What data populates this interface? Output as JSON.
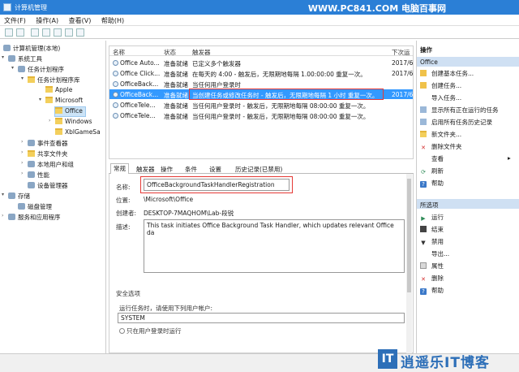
{
  "window": {
    "title": "计算机管理",
    "watermark": "WWW.PC841.COM 电脑百事网"
  },
  "menu": [
    "文件(F)",
    "操作(A)",
    "查看(V)",
    "帮助(H)"
  ],
  "tree": [
    {
      "label": "计算机管理(本地)",
      "icon": "computer-icon"
    },
    {
      "label": "系统工具",
      "icon": "tools-icon"
    },
    {
      "label": "任务计划程序",
      "icon": "clock-icon"
    },
    {
      "label": "任务计划程序库",
      "icon": "folder-icon"
    },
    {
      "label": "Apple",
      "icon": "folder-icon"
    },
    {
      "label": "Microsoft",
      "icon": "folder-icon"
    },
    {
      "label": "Office",
      "icon": "folder-icon"
    },
    {
      "label": "Windows",
      "icon": "folder-icon"
    },
    {
      "label": "XblGameSa",
      "icon": "folder-icon"
    },
    {
      "label": "事件查看器",
      "icon": "event-icon"
    },
    {
      "label": "共享文件夹",
      "icon": "share-icon"
    },
    {
      "label": "本地用户和组",
      "icon": "users-icon"
    },
    {
      "label": "性能",
      "icon": "performance-icon"
    },
    {
      "label": "设备管理器",
      "icon": "device-icon"
    },
    {
      "label": "存储",
      "icon": "storage-icon"
    },
    {
      "label": "磁盘管理",
      "icon": "disk-icon"
    },
    {
      "label": "服务和应用程序",
      "icon": "services-icon"
    }
  ],
  "tasks": {
    "headers": [
      "名称",
      "状态",
      "触发器",
      "下次运"
    ],
    "rows": [
      {
        "name": "Office Auto...",
        "status": "准备就绪",
        "trigger": "已定义多个触发器",
        "next": "2017/6"
      },
      {
        "name": "Office Click...",
        "status": "准备就绪",
        "trigger": "在每天的 4:00 - 触发后，无限期地每隔 1.00:00:00 重复一次。",
        "next": "2017/6"
      },
      {
        "name": "OfficeBack...",
        "status": "准备就绪",
        "trigger": "当任何用户登录时",
        "next": ""
      },
      {
        "name": "OfficeBack...",
        "status": "准备就绪",
        "trigger": "当创建任务或修改任务时 - 触发后，无限期地每隔 1 小时 重复一次。",
        "next": "2017/6"
      },
      {
        "name": "OfficeTele...",
        "status": "准备就绪",
        "trigger": "当任何用户登录时 - 触发后，无限期地每隔 08:00:00 重复一次。",
        "next": ""
      },
      {
        "name": "OfficeTele...",
        "status": "准备就绪",
        "trigger": "当任何用户登录时 - 触发后，无限期地每隔 08:00:00 重复一次。",
        "next": ""
      }
    ]
  },
  "tabs": [
    "常规",
    "触发器",
    "操作",
    "条件",
    "设置",
    "历史记录(已禁用)"
  ],
  "detail": {
    "name_label": "名称:",
    "name_value": "OfficeBackgroundTaskHandlerRegistration",
    "location_label": "位置:",
    "location_value": "\\Microsoft\\Office",
    "author_label": "创建者:",
    "author_value": "DESKTOP-7MAQHOM\\Lab-段锐",
    "desc_label": "描述:",
    "desc_value": "This task initiates Office Background Task Handler, which updates relevant Office da",
    "security_header": "安全选项",
    "run_as_label": "运行任务时，请使用下列用户帐户:",
    "run_as_value": "SYSTEM",
    "opt1": "只在用户登录时运行"
  },
  "actions": {
    "header": "操作",
    "section1": "Office",
    "items1": [
      {
        "label": "创建基本任务...",
        "icon": "create-basic-task-icon"
      },
      {
        "label": "创建任务...",
        "icon": "create-task-icon"
      },
      {
        "label": "导入任务...",
        "icon": "import-icon"
      },
      {
        "label": "显示所有正在运行的任务",
        "icon": "running-tasks-icon"
      },
      {
        "label": "启用所有任务历史记录",
        "icon": "history-icon"
      },
      {
        "label": "新文件夹...",
        "icon": "new-folder-icon"
      },
      {
        "label": "删除文件夹",
        "icon": "delete-icon"
      },
      {
        "label": "查看",
        "icon": "view-icon"
      },
      {
        "label": "刷新",
        "icon": "refresh-icon"
      },
      {
        "label": "帮助",
        "icon": "help-icon"
      }
    ],
    "section2": "所选项",
    "items2": [
      {
        "label": "运行",
        "icon": "run-icon"
      },
      {
        "label": "结束",
        "icon": "end-icon"
      },
      {
        "label": "禁用",
        "icon": "disable-icon"
      },
      {
        "label": "导出...",
        "icon": "export-icon"
      },
      {
        "label": "属性",
        "icon": "properties-icon"
      },
      {
        "label": "删除",
        "icon": "delete-icon"
      },
      {
        "label": "帮助",
        "icon": "help-icon"
      }
    ]
  },
  "logo": {
    "text": "逍遥乐IT博客",
    "mark": "IT"
  },
  "colors": {
    "accent": "#2b7fd6",
    "selection": "#3399ff",
    "highlight": "#e53935"
  }
}
